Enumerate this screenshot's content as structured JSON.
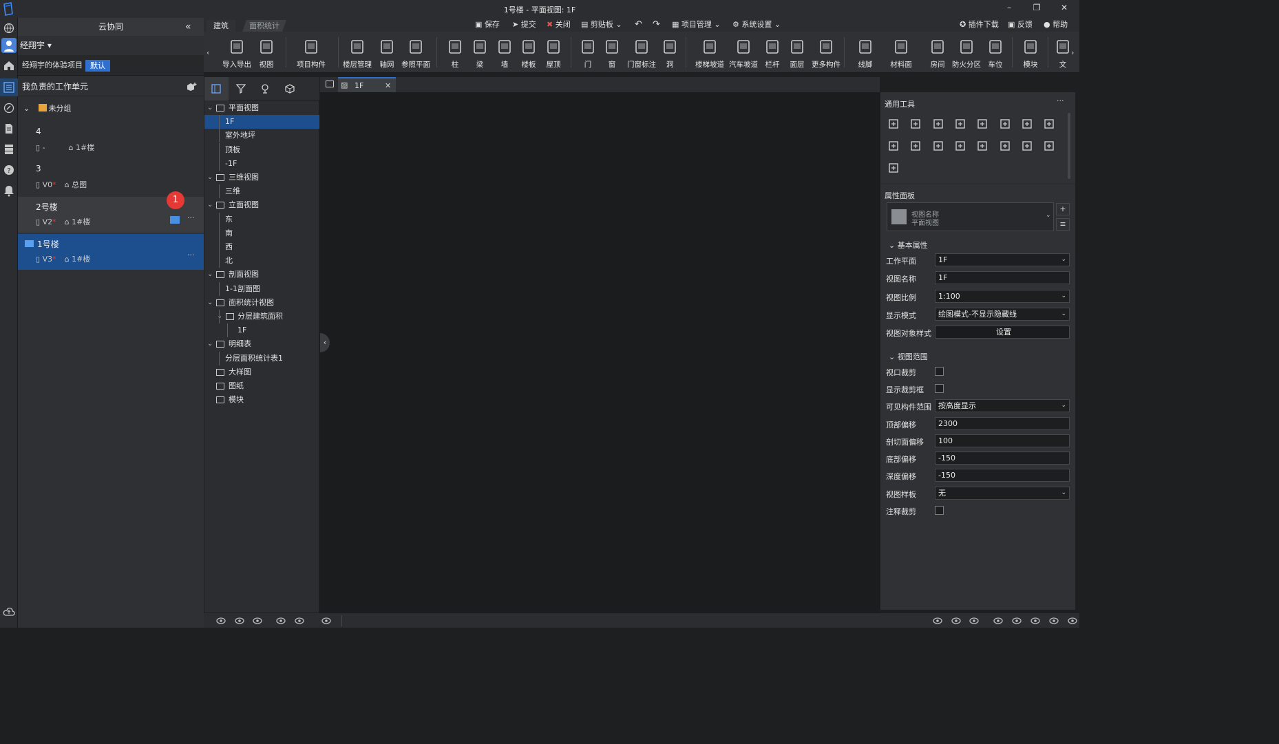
{
  "window": {
    "title": "1号楼 - 平面视图: 1F",
    "minimize": "–",
    "maximize": "❐",
    "close": "✕"
  },
  "quick_access": {
    "save": "保存",
    "submit": "提交",
    "close": "关闭",
    "clipboard": "剪贴板",
    "project_mgmt": "项目管理",
    "system_settings": "系统设置",
    "plugin_download": "插件下载",
    "feedback": "反馈",
    "help": "帮助"
  },
  "left_panel": {
    "title": "云协同",
    "collapse": "«",
    "user": "经翔宇 ▾",
    "project": "经翔宇的体验项目",
    "project_badge": "默认",
    "work_header": "我负责的工作单元",
    "group": "未分组",
    "units": [
      {
        "name": "4",
        "version": "-",
        "star": "",
        "floor": "1#楼"
      },
      {
        "name": "3",
        "version": "V0",
        "star": "*",
        "floor": "总图"
      },
      {
        "name": "2号楼",
        "version": "V2",
        "star": "*",
        "floor": "1#楼",
        "badge": "1",
        "more": "···"
      },
      {
        "name": "1号楼",
        "version": "V3",
        "star": "*",
        "floor": "1#楼",
        "more": "···"
      }
    ]
  },
  "ribbon": {
    "tabs": [
      "建筑",
      "面积统计"
    ],
    "buttons": [
      "导入导出",
      "视图",
      "项目构件",
      "楼层管理",
      "轴网",
      "参照平面",
      "柱",
      "梁",
      "墙",
      "楼板",
      "屋顶",
      "门",
      "窗",
      "门窗标注",
      "洞",
      "楼梯坡道",
      "汽车坡道",
      "栏杆",
      "面层",
      "更多构件",
      "线脚",
      "材料面",
      "房间",
      "防火分区",
      "车位",
      "模块",
      "文"
    ]
  },
  "tree": {
    "nodes": [
      {
        "label": "平面视图",
        "level": 0,
        "expand": "v"
      },
      {
        "label": "1F",
        "level": 1,
        "selected": true
      },
      {
        "label": "室外地坪",
        "level": 1
      },
      {
        "label": "顶板",
        "level": 1
      },
      {
        "label": "-1F",
        "level": 1
      },
      {
        "label": "三维视图",
        "level": 0,
        "expand": "v"
      },
      {
        "label": "三维",
        "level": 1
      },
      {
        "label": "立面视图",
        "level": 0,
        "expand": "v"
      },
      {
        "label": "东",
        "level": 1
      },
      {
        "label": "南",
        "level": 1
      },
      {
        "label": "西",
        "level": 1
      },
      {
        "label": "北",
        "level": 1
      },
      {
        "label": "剖面视图",
        "level": 0,
        "expand": "v"
      },
      {
        "label": "1-1剖面图",
        "level": 1
      },
      {
        "label": "面积统计视图",
        "level": 0,
        "expand": "v"
      },
      {
        "label": "分层建筑面积",
        "level": 1,
        "expand": "v"
      },
      {
        "label": "1F",
        "level": 2
      },
      {
        "label": "明细表",
        "level": 0,
        "expand": "v"
      },
      {
        "label": "分层面积统计表1",
        "level": 1
      },
      {
        "label": "大样图",
        "level": 0
      },
      {
        "label": "图纸",
        "level": 0
      },
      {
        "label": "模块",
        "level": 0
      }
    ]
  },
  "view_tab": {
    "label": "1F",
    "close": "✕"
  },
  "general_tools": {
    "title": "通用工具",
    "more": "···"
  },
  "properties": {
    "title": "属性面板",
    "selector_line1": "视图名称",
    "selector_line2": "平面视图",
    "basic_section": "基本属性",
    "basic": [
      {
        "label": "工作平面",
        "value": "1F",
        "type": "dropdown"
      },
      {
        "label": "视图名称",
        "value": "1F",
        "type": "text"
      },
      {
        "label": "视图比例",
        "value": "1:100",
        "type": "dropdown"
      },
      {
        "label": "显示模式",
        "value": "绘图模式-不显示隐藏线",
        "type": "dropdown"
      },
      {
        "label": "视图对象样式",
        "value": "设置",
        "type": "button"
      }
    ],
    "range_section": "视图范围",
    "range": [
      {
        "label": "视口裁剪",
        "type": "checkbox",
        "checked": false
      },
      {
        "label": "显示裁剪框",
        "type": "checkbox",
        "checked": false
      },
      {
        "label": "可见构件范围",
        "value": "按高度显示",
        "type": "dropdown"
      },
      {
        "label": "顶部偏移",
        "value": "2300",
        "type": "text"
      },
      {
        "label": "剖切面偏移",
        "value": "100",
        "type": "text"
      },
      {
        "label": "底部偏移",
        "value": "-150",
        "type": "text"
      },
      {
        "label": "深度偏移",
        "value": "-150",
        "type": "text"
      },
      {
        "label": "视图样板",
        "value": "无",
        "type": "dropdown"
      },
      {
        "label": "注释裁剪",
        "type": "checkbox",
        "checked": false
      }
    ]
  },
  "colors": {
    "accent": "#2f6fd0",
    "selection": "#1d4f8f",
    "badge": "#e53935",
    "bg": "#1b1c1e"
  }
}
